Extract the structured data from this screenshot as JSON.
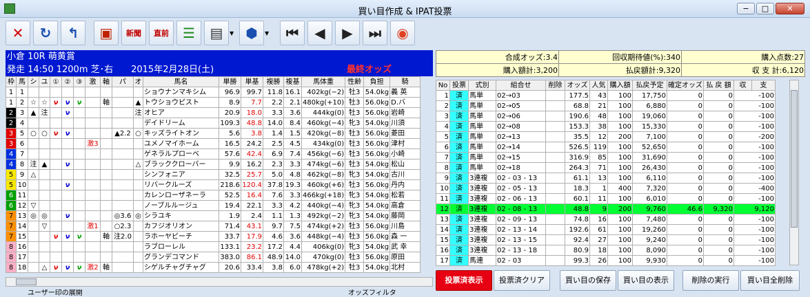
{
  "window": {
    "title": "買い目作成 & IPAT投票",
    "min": "−",
    "max": "□",
    "close": "✕"
  },
  "toolbar": {
    "items": [
      {
        "name": "close-x-icon",
        "glyph": "✕",
        "color": "#d00000"
      },
      {
        "name": "refresh-icon",
        "glyph": "↻",
        "color": "#1a4fb0"
      },
      {
        "name": "return-icon",
        "glyph": "↰",
        "color": "#1a4fb0"
      },
      {
        "name": "screen-icon",
        "glyph": "▣",
        "color": "#c02000"
      },
      {
        "name": "new-race-icon",
        "glyph": "新聞",
        "color": "#c00000"
      },
      {
        "name": "direct-icon",
        "glyph": "直前",
        "color": "#c00000"
      },
      {
        "name": "list-icon",
        "glyph": "☰",
        "color": "#1a8a1a"
      },
      {
        "name": "document-icon",
        "glyph": "▤",
        "color": "#333"
      },
      {
        "name": "vote-icon",
        "glyph": "⬢",
        "color": "#1a4fb0"
      },
      {
        "name": "first-icon",
        "glyph": "⏮",
        "color": "#222"
      },
      {
        "name": "prev-icon",
        "glyph": "◀",
        "color": "#222"
      },
      {
        "name": "next-icon",
        "glyph": "▶",
        "color": "#222"
      },
      {
        "name": "last-icon",
        "glyph": "⏭",
        "color": "#222"
      },
      {
        "name": "ipat-logo-icon",
        "glyph": "◉",
        "color": "#e04020"
      }
    ]
  },
  "race": {
    "line1": "小倉 10R 萌黄賞",
    "line2": "発走 14:50 1200m 芝･右　　2015年2月28日(土)",
    "final": "最終オッズ"
  },
  "horse_headers": [
    "枠",
    "馬",
    "シ",
    "ユ",
    "①",
    "②",
    "③",
    "激",
    "軸",
    "パ",
    "オ",
    "馬名",
    "単勝",
    "単基",
    "複勝",
    "複基",
    "馬体重",
    "性齢",
    "負担",
    "騎"
  ],
  "waku_colors": {
    "1": "#ffffff",
    "2": "#000000",
    "3": "#e00000",
    "4": "#0030e0",
    "5": "#f8e800",
    "6": "#00a000",
    "7": "#ff9000",
    "8": "#ffb0c8"
  },
  "horses": [
    {
      "w": "1",
      "b": "1",
      "s": "",
      "y": "",
      "m1": "",
      "m2": "",
      "m3": "",
      "g": "",
      "j": "",
      "p": "",
      "o": "",
      "name": "ショウナンマキシム",
      "tan": "96.9",
      "tk": "99.7",
      "fuku": "11.8",
      "fk": "16.1",
      "bw": "402kg(−2)",
      "sa": "牡3",
      "ft": "54.0kg",
      "jk": "義 英"
    },
    {
      "w": "1",
      "b": "2",
      "s": "☆",
      "y": "☆",
      "m1": "ν",
      "m2": "ν",
      "m3": "ν",
      "g": "",
      "j": "軸",
      "p": "",
      "o": "▲",
      "name": "トウショウピスト",
      "tan": "8.9",
      "tk": "7.7",
      "fuku": "2.2",
      "fk": "2.1",
      "bw": "480kg(+10)",
      "sa": "牡3",
      "ft": "56.0kg",
      "jk": "D.バ"
    },
    {
      "w": "2",
      "b": "3",
      "s": "▲",
      "y": "注",
      "m1": "",
      "m2": "ν",
      "m3": "",
      "g": "",
      "j": "",
      "p": "",
      "o": "注",
      "name": "オヒア",
      "tan": "20.9",
      "tk": "18.0",
      "fuku": "3.3",
      "fk": "3.6",
      "bw": "444kg(0)",
      "sa": "牡3",
      "ft": "56.0kg",
      "jk": "岩崎"
    },
    {
      "w": "2",
      "b": "4",
      "s": "",
      "y": "",
      "m1": "",
      "m2": "",
      "m3": "",
      "g": "",
      "j": "",
      "p": "",
      "o": "",
      "name": "デイドリーム",
      "tan": "109.3",
      "tk": "48.8",
      "fuku": "14.0",
      "fk": "8.4",
      "bw": "460kg(−4)",
      "sa": "牝3",
      "ft": "54.0kg",
      "jk": "川須"
    },
    {
      "w": "3",
      "b": "5",
      "s": "○",
      "y": "○",
      "m1": "ν",
      "m2": "ν",
      "m3": "",
      "g": "",
      "j": "",
      "p": "▲2.2",
      "o": "○",
      "name": "キッズライトオン",
      "tan": "5.6",
      "tk": "3.8",
      "fuku": "1.4",
      "fk": "1.5",
      "bw": "420kg(−8)",
      "sa": "牡3",
      "ft": "56.0kg",
      "jk": "菱田"
    },
    {
      "w": "3",
      "b": "6",
      "s": "",
      "y": "",
      "m1": "",
      "m2": "",
      "m3": "",
      "g": "激3",
      "j": "",
      "p": "",
      "o": "",
      "name": "ユメノマイホーム",
      "tan": "16.5",
      "tk": "24.2",
      "fuku": "2.5",
      "fk": "4.5",
      "bw": "434kg(0)",
      "sa": "牡3",
      "ft": "56.0kg",
      "jk": "津村"
    },
    {
      "w": "4",
      "b": "7",
      "s": "",
      "y": "",
      "m1": "",
      "m2": "",
      "m3": "",
      "g": "",
      "j": "",
      "p": "",
      "o": "",
      "name": "ゲネラルプローベ",
      "tan": "57.6",
      "tk": "42.4",
      "fuku": "6.9",
      "fk": "7.4",
      "bw": "456kg(−6)",
      "sa": "牡3",
      "ft": "56.0kg",
      "jk": "小崎"
    },
    {
      "w": "4",
      "b": "8",
      "s": "注",
      "y": "▲",
      "m1": "",
      "m2": "ν",
      "m3": "",
      "g": "",
      "j": "",
      "p": "",
      "o": "△",
      "name": "ブラッククローバー",
      "tan": "9.9",
      "tk": "16.2",
      "fuku": "2.3",
      "fk": "3.3",
      "bw": "474kg(−6)",
      "sa": "牡3",
      "ft": "54.0kg",
      "jk": "松山"
    },
    {
      "w": "5",
      "b": "9",
      "s": "△",
      "y": "",
      "m1": "",
      "m2": "",
      "m3": "",
      "g": "",
      "j": "",
      "p": "",
      "o": "",
      "name": "シンフォニア",
      "tan": "32.5",
      "tk": "25.7",
      "fuku": "5.0",
      "fk": "4.8",
      "bw": "462kg(−8)",
      "sa": "牝3",
      "ft": "54.0kg",
      "jk": "古川"
    },
    {
      "w": "5",
      "b": "10",
      "s": "",
      "y": "",
      "m1": "",
      "m2": "ν",
      "m3": "",
      "g": "",
      "j": "",
      "p": "",
      "o": "",
      "name": "リバークルーズ",
      "tan": "218.6",
      "tk": "120.4",
      "fuku": "37.8",
      "fk": "19.3",
      "bw": "460kg(+6)",
      "sa": "牡3",
      "ft": "56.0kg",
      "jk": "丹内"
    },
    {
      "w": "6",
      "b": "11",
      "s": "",
      "y": "",
      "m1": "",
      "m2": "",
      "m3": "",
      "g": "",
      "j": "",
      "p": "",
      "o": "",
      "name": "カレンローザネーラ",
      "tan": "52.5",
      "tk": "16.4",
      "fuku": "7.6",
      "fk": "3.3",
      "bw": "466kg(+18)",
      "sa": "牝3",
      "ft": "54.0kg",
      "jk": "松若"
    },
    {
      "w": "6",
      "b": "12",
      "s": "▽",
      "y": "",
      "m1": "",
      "m2": "",
      "m3": "",
      "g": "",
      "j": "",
      "p": "",
      "o": "",
      "name": "ノーブルルージュ",
      "tan": "19.4",
      "tk": "22.1",
      "fuku": "3.3",
      "fk": "4.2",
      "bw": "440kg(−4)",
      "sa": "牝3",
      "ft": "54.0kg",
      "jk": "高倉"
    },
    {
      "w": "7",
      "b": "13",
      "s": "◎",
      "y": "◎",
      "m1": "",
      "m2": "ν",
      "m3": "",
      "g": "",
      "j": "",
      "p": "◎3.6",
      "o": "◎",
      "name": "シラユキ",
      "tan": "1.9",
      "tk": "2.4",
      "fuku": "1.1",
      "fk": "1.3",
      "bw": "492kg(−2)",
      "sa": "牝3",
      "ft": "54.0kg",
      "jk": "藤岡"
    },
    {
      "w": "7",
      "b": "14",
      "s": "",
      "y": "▽",
      "m1": "",
      "m2": "",
      "m3": "",
      "g": "激1",
      "j": "",
      "p": "○2.3",
      "o": "",
      "name": "カフジオリオン",
      "tan": "71.4",
      "tk": "43.1",
      "fuku": "9.7",
      "fk": "7.5",
      "bw": "474kg(+2)",
      "sa": "牡3",
      "ft": "56.0kg",
      "jk": "川島"
    },
    {
      "w": "7",
      "b": "15",
      "s": "",
      "y": "",
      "m1": "ν",
      "m2": "ν",
      "m3": "ν",
      "g": "",
      "j": "軸",
      "p": "注2.0",
      "o": "",
      "name": "ラホーヤビーチ",
      "tan": "33.7",
      "tk": "17.9",
      "fuku": "4.6",
      "fk": "3.6",
      "bw": "448kg(−4)",
      "sa": "牡3",
      "ft": "56.0kg",
      "jk": "森 一"
    },
    {
      "w": "8",
      "b": "16",
      "s": "",
      "y": "",
      "m1": "",
      "m2": "",
      "m3": "",
      "g": "",
      "j": "",
      "p": "",
      "o": "",
      "name": "ラブローレル",
      "tan": "133.1",
      "tk": "23.2",
      "fuku": "17.2",
      "fk": "4.4",
      "bw": "406kg(0)",
      "sa": "牝3",
      "ft": "54.0kg",
      "jk": "武 幸"
    },
    {
      "w": "8",
      "b": "17",
      "s": "",
      "y": "",
      "m1": "",
      "m2": "",
      "m3": "",
      "g": "",
      "j": "",
      "p": "",
      "o": "",
      "name": "グランデコマンド",
      "tan": "383.0",
      "tk": "86.1",
      "fuku": "48.9",
      "fk": "14.0",
      "bw": "470kg(0)",
      "sa": "牡3",
      "ft": "56.0kg",
      "jk": "原田"
    },
    {
      "w": "8",
      "b": "18",
      "s": "",
      "y": "△",
      "m1": "ν",
      "m2": "ν",
      "m3": "ν",
      "g": "激2",
      "j": "軸",
      "p": "",
      "o": "",
      "name": "シゲルチャグチャグ",
      "tan": "20.6",
      "tk": "33.4",
      "fuku": "3.8",
      "fk": "6.0",
      "bw": "478kg(+2)",
      "sa": "牡3",
      "ft": "54.0kg",
      "jk": "北村"
    }
  ],
  "summary": {
    "synth_odds": "合成オッズ:3.4",
    "recovery": "回収期待値(%):340",
    "points": "購入点数:27",
    "purchase_total": "購入額計:3,200",
    "payback_total": "払戻額計:9,320",
    "balance": "収 支 計:6,120"
  },
  "bet_headers": [
    "No",
    "投票",
    "式別",
    "組合せ",
    "削除",
    "オッズ",
    "人気",
    "購入額",
    "払戻予定",
    "確定オッズ",
    "払 戻 額",
    "収",
    "支"
  ],
  "bets": [
    {
      "no": "1",
      "v": "済",
      "t": "馬単",
      "c": "02→03",
      "o": "177.5",
      "p": "43",
      "a": "100",
      "r": "17,750",
      "fo": "0",
      "pb": "0",
      "bal": "-100"
    },
    {
      "no": "2",
      "v": "済",
      "t": "馬単",
      "c": "02→05",
      "o": "68.8",
      "p": "21",
      "a": "100",
      "r": "6,880",
      "fo": "0",
      "pb": "0",
      "bal": "-100"
    },
    {
      "no": "3",
      "v": "済",
      "t": "馬単",
      "c": "02→06",
      "o": "190.6",
      "p": "48",
      "a": "100",
      "r": "19,060",
      "fo": "0",
      "pb": "0",
      "bal": "-100"
    },
    {
      "no": "4",
      "v": "済",
      "t": "馬単",
      "c": "02→08",
      "o": "153.3",
      "p": "38",
      "a": "100",
      "r": "15,330",
      "fo": "0",
      "pb": "0",
      "bal": "-100"
    },
    {
      "no": "5",
      "v": "済",
      "t": "馬単",
      "c": "02→13",
      "o": "35.5",
      "p": "12",
      "a": "200",
      "r": "7,100",
      "fo": "0",
      "pb": "0",
      "bal": "-200"
    },
    {
      "no": "6",
      "v": "済",
      "t": "馬単",
      "c": "02→14",
      "o": "526.5",
      "p": "119",
      "a": "100",
      "r": "52,650",
      "fo": "0",
      "pb": "0",
      "bal": "-100"
    },
    {
      "no": "7",
      "v": "済",
      "t": "馬単",
      "c": "02→15",
      "o": "316.9",
      "p": "85",
      "a": "100",
      "r": "31,690",
      "fo": "0",
      "pb": "0",
      "bal": "-100"
    },
    {
      "no": "8",
      "v": "済",
      "t": "馬単",
      "c": "02→18",
      "o": "264.3",
      "p": "71",
      "a": "100",
      "r": "26,430",
      "fo": "0",
      "pb": "0",
      "bal": "-100"
    },
    {
      "no": "9",
      "v": "済",
      "t": "3連複",
      "c": "02 - 03 - 13",
      "o": "61.1",
      "p": "13",
      "a": "100",
      "r": "6,110",
      "fo": "0",
      "pb": "0",
      "bal": "-100"
    },
    {
      "no": "10",
      "v": "済",
      "t": "3連複",
      "c": "02 - 05 - 13",
      "o": "18.3",
      "p": "1",
      "a": "400",
      "r": "7,320",
      "fo": "0",
      "pb": "0",
      "bal": "-400"
    },
    {
      "no": "11",
      "v": "済",
      "t": "3連複",
      "c": "02 - 06 - 13",
      "o": "60.1",
      "p": "11",
      "a": "100",
      "r": "6,010",
      "fo": "0",
      "pb": "0",
      "bal": "-100"
    },
    {
      "no": "12",
      "v": "済",
      "t": "3連複",
      "c": "02 - 08 - 13",
      "o": "48.8",
      "p": "9",
      "a": "200",
      "r": "9,760",
      "fo": "46.6",
      "pb": "9,320",
      "bal": "9,120"
    },
    {
      "no": "13",
      "v": "済",
      "t": "3連複",
      "c": "02 - 09 - 13",
      "o": "74.8",
      "p": "16",
      "a": "100",
      "r": "7,480",
      "fo": "0",
      "pb": "0",
      "bal": "-100"
    },
    {
      "no": "14",
      "v": "済",
      "t": "3連複",
      "c": "02 - 13 - 14",
      "o": "192.6",
      "p": "61",
      "a": "100",
      "r": "19,260",
      "fo": "0",
      "pb": "0",
      "bal": "-100"
    },
    {
      "no": "15",
      "v": "済",
      "t": "3連複",
      "c": "02 - 13 - 15",
      "o": "92.4",
      "p": "27",
      "a": "100",
      "r": "9,240",
      "fo": "0",
      "pb": "0",
      "bal": "-100"
    },
    {
      "no": "16",
      "v": "済",
      "t": "3連複",
      "c": "02 - 13 - 18",
      "o": "80.9",
      "p": "18",
      "a": "100",
      "r": "8,090",
      "fo": "0",
      "pb": "0",
      "bal": "-100"
    },
    {
      "no": "17",
      "v": "済",
      "t": "馬連",
      "c": "02 - 03",
      "o": "99.3",
      "p": "26",
      "a": "100",
      "r": "9,930",
      "fo": "0",
      "pb": "0",
      "bal": "-100"
    }
  ],
  "buttons": {
    "voted_show": "投票済表示",
    "voted_clear": "投票済クリア",
    "save": "買い目の保存",
    "show": "買い目の表示",
    "exec_delete": "削除の実行",
    "delete_all": "買い目全削除"
  },
  "footer": {
    "left": "ユーザー印の展開",
    "right": "オッズフィルタ"
  }
}
